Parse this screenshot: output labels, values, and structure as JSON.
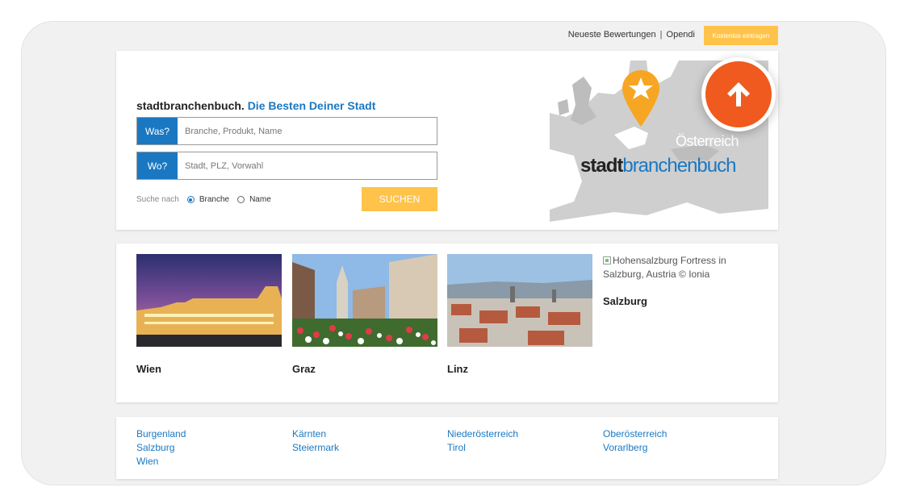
{
  "topbar": {
    "link_reviews": "Neueste Bewertungen",
    "separator": "|",
    "link_opendi": "Opendi",
    "cta_label": "Kostenlos eintragen"
  },
  "hero": {
    "brand_name": "stadtbranchenbuch.",
    "brand_tagline": "Die Besten Deiner Stadt",
    "what_label": "Was?",
    "what_placeholder": "Branche, Produkt, Name",
    "where_label": "Wo?",
    "where_placeholder": "Stadt, PLZ, Vorwahl",
    "search_by_label": "Suche nach",
    "radio_options": [
      "Branche",
      "Name"
    ],
    "radio_selected": "Branche",
    "search_button": "SUCHEN",
    "map": {
      "country_label": "Österreich",
      "logo_part1": "stadt",
      "logo_part2": "branchenbuch",
      "pin_icon": "star-pin-icon"
    }
  },
  "scroll_top_icon": "arrow-up-icon",
  "cities": [
    {
      "name": "Wien"
    },
    {
      "name": "Graz"
    },
    {
      "name": "Linz"
    }
  ],
  "salzburg": {
    "alt_text": "Hohensalzburg Fortress in Salzburg, Austria © Ionia",
    "name": "Salzburg"
  },
  "regions": {
    "col1": [
      "Burgenland",
      "Salzburg",
      "Wien"
    ],
    "col2": [
      "Kärnten",
      "Steiermark"
    ],
    "col3": [
      "Niederösterreich",
      "Tirol"
    ],
    "col4": [
      "Oberösterreich",
      "Vorarlberg"
    ]
  },
  "colors": {
    "accent_blue": "#1a78c2",
    "cta_yellow": "#ffc34a",
    "scroll_orange": "#f05a1e",
    "pin_orange": "#f6a623"
  }
}
